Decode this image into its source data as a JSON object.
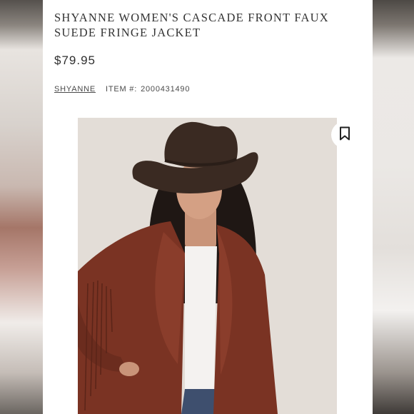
{
  "product": {
    "title": "SHYANNE WOMEN'S CASCADE FRONT FAUX SUEDE FRINGE JACKET",
    "price": "$79.95",
    "brand": "SHYANNE",
    "item_label": "ITEM #:",
    "item_number": "2000431490"
  },
  "image": {
    "alt": "Model wearing rust faux suede fringe jacket and brown cowboy hat"
  },
  "icons": {
    "bookmark": "bookmark-icon"
  },
  "colors": {
    "jacket": "#7a3323",
    "hat": "#3a2a22",
    "photo_bg": "#e3ddd7"
  }
}
